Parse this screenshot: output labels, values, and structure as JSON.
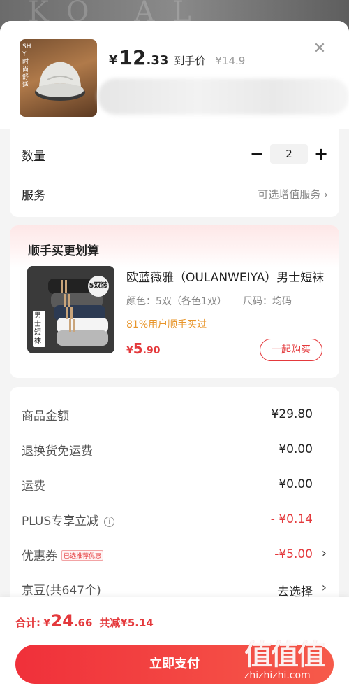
{
  "colors": {
    "accent": "#e4393c",
    "popular": "#e8952a",
    "muted": "#888888"
  },
  "product": {
    "image_label": "SHY时尚 舒适",
    "price_currency": "¥",
    "price_int": "12",
    "price_dec": ".33",
    "price_tag": "到手价",
    "original_price": "¥14.9"
  },
  "options": {
    "quantity_label": "数量",
    "quantity_value": "2",
    "minus_symbol": "−",
    "plus_symbol": "+",
    "service_label": "服务",
    "service_link": "可选增值服务 ›"
  },
  "addon": {
    "title": "顺手买更划算",
    "image_badge": "5双装",
    "image_tag": "男士短袜",
    "name": "欧蓝薇雅（OULANWEIYA）男士短袜",
    "spec_color": "颜色：5双（各色1双）",
    "spec_size": "尺码：均码",
    "popularity": "81%用户顺手买过",
    "price_symbol": "¥",
    "price_int": "5",
    "price_dec": ".90",
    "button": "一起购买"
  },
  "fees": [
    {
      "label": "商品金额",
      "value": "¥29.80"
    },
    {
      "label": "退换货免运费",
      "value": "¥0.00"
    },
    {
      "label": "运费",
      "value": "¥0.00"
    },
    {
      "label": "PLUS专享立减",
      "value": "- ¥0.14",
      "info_icon": "ⓘ"
    },
    {
      "label": "优惠券",
      "value": "-¥5.00",
      "badge": "已选推荐优惠",
      "chevron": "›"
    },
    {
      "label": "京豆(共647个)",
      "value": "去选择",
      "chevron": "›"
    }
  ],
  "footer": {
    "total_label": "合计:",
    "total_currency": "¥",
    "total_int": "24",
    "total_dec": ".66",
    "saved": "共减¥5.14",
    "pay_button": "立即支付"
  },
  "watermark": {
    "big": "值值值",
    "small": "zhizhizhi.com"
  },
  "background": {
    "letters": "KO  AL"
  }
}
